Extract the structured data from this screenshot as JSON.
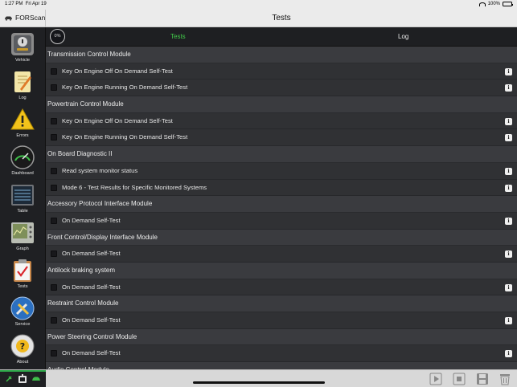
{
  "status_bar": {
    "time": "1:27 PM",
    "date": "Fri Apr 19",
    "battery": "100%"
  },
  "nav": {
    "app_name": "FORScan",
    "title": "Tests"
  },
  "sidebar": {
    "items": [
      {
        "label": "Vehicle",
        "icon": "vehicle-icon"
      },
      {
        "label": "Log",
        "icon": "log-icon"
      },
      {
        "label": "Errors",
        "icon": "errors-icon"
      },
      {
        "label": "Dashboard",
        "icon": "dashboard-icon"
      },
      {
        "label": "Table",
        "icon": "table-icon"
      },
      {
        "label": "Graph",
        "icon": "graph-icon"
      },
      {
        "label": "Tests",
        "icon": "tests-icon"
      },
      {
        "label": "Service",
        "icon": "service-icon"
      },
      {
        "label": "About",
        "icon": "about-icon"
      }
    ]
  },
  "tabs": {
    "progress": "0%",
    "tests": "Tests",
    "log": "Log"
  },
  "sections": [
    {
      "title": "Transmission Control Module",
      "tests": [
        "Key On Engine Off On Demand Self-Test",
        "Key On Engine Running On Demand Self-Test"
      ]
    },
    {
      "title": "Powertrain Control Module",
      "tests": [
        "Key On Engine Off On Demand Self-Test",
        "Key On Engine Running On Demand Self-Test"
      ]
    },
    {
      "title": "On Board Diagnostic II",
      "tests": [
        "Read system monitor status",
        "Mode 6 - Test Results for Specific Monitored Systems"
      ]
    },
    {
      "title": "Accessory Protocol Interface Module",
      "tests": [
        "On Demand Self-Test"
      ]
    },
    {
      "title": "Front Control/Display Interface Module",
      "tests": [
        "On Demand Self-Test"
      ]
    },
    {
      "title": "Antilock braking system",
      "tests": [
        "On Demand Self-Test"
      ]
    },
    {
      "title": "Restraint Control Module",
      "tests": [
        "On Demand Self-Test"
      ]
    },
    {
      "title": "Power Steering Control Module",
      "tests": [
        "On Demand Self-Test"
      ]
    },
    {
      "title": "Audio Control Module",
      "tests": []
    }
  ],
  "info_label": "i",
  "bottom_bar": {
    "buttons": [
      "play-icon",
      "stop-icon",
      "save-icon",
      "trash-icon"
    ]
  },
  "colors": {
    "accent_green": "#42c94a",
    "sidebar_bg": "#1f2023",
    "content_bg": "#2b2c30"
  }
}
